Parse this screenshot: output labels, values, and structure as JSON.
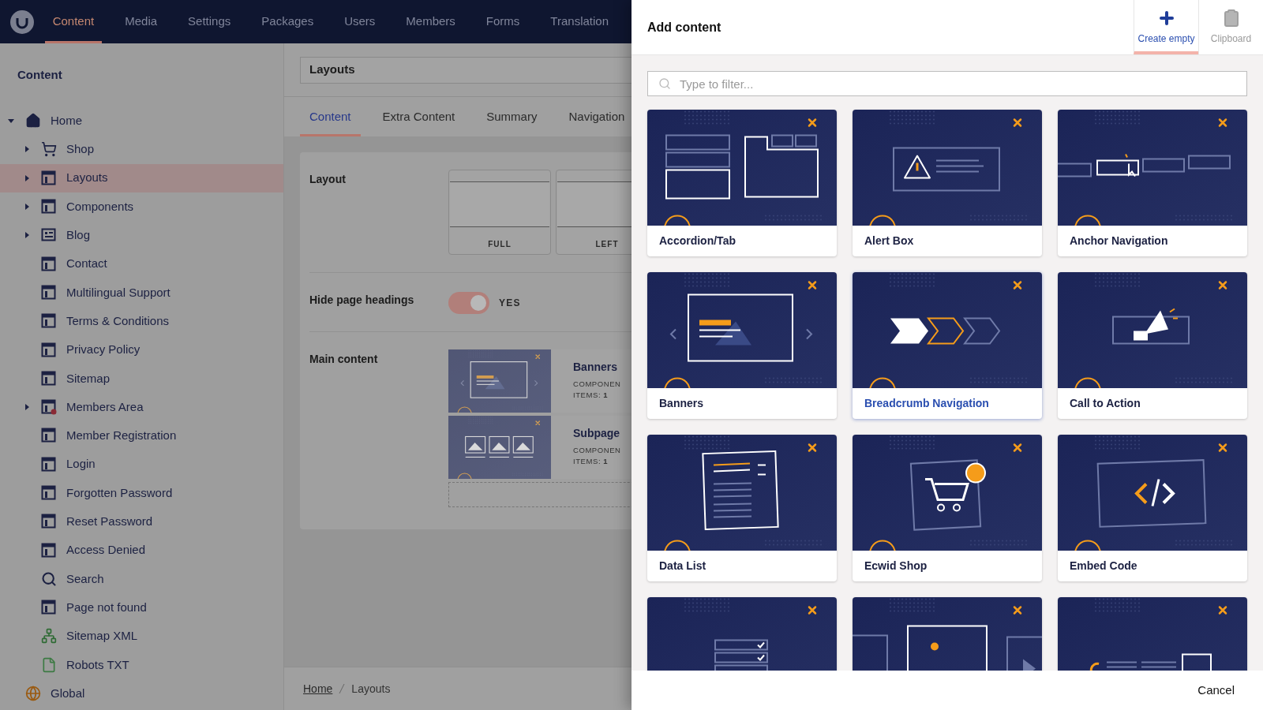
{
  "top_nav": {
    "items": [
      {
        "label": "Content",
        "selected": true
      },
      {
        "label": "Media",
        "selected": false
      },
      {
        "label": "Settings",
        "selected": false
      },
      {
        "label": "Packages",
        "selected": false
      },
      {
        "label": "Users",
        "selected": false
      },
      {
        "label": "Members",
        "selected": false
      },
      {
        "label": "Forms",
        "selected": false
      },
      {
        "label": "Translation",
        "selected": false
      }
    ]
  },
  "sidebar": {
    "title": "Content",
    "tree": [
      {
        "label": "Home",
        "kind": "home",
        "expandable": true,
        "expanded": true,
        "selected": false,
        "children": [
          {
            "label": "Shop",
            "kind": "cart",
            "expandable": true,
            "expanded": false,
            "selected": false
          },
          {
            "label": "Layouts",
            "kind": "layout",
            "expandable": true,
            "expanded": false,
            "selected": true
          },
          {
            "label": "Components",
            "kind": "layout",
            "expandable": true,
            "expanded": false,
            "selected": false
          },
          {
            "label": "Blog",
            "kind": "blog",
            "expandable": true,
            "expanded": false,
            "selected": false
          },
          {
            "label": "Contact",
            "kind": "layout",
            "expandable": false,
            "expanded": false,
            "selected": false
          },
          {
            "label": "Multilingual Support",
            "kind": "layout",
            "expandable": false,
            "expanded": false,
            "selected": false
          },
          {
            "label": "Terms & Conditions",
            "kind": "layout",
            "expandable": false,
            "expanded": false,
            "selected": false
          },
          {
            "label": "Privacy Policy",
            "kind": "layout",
            "expandable": false,
            "expanded": false,
            "selected": false
          },
          {
            "label": "Sitemap",
            "kind": "layout",
            "expandable": false,
            "expanded": false,
            "selected": false
          },
          {
            "label": "Members Area",
            "kind": "restricted",
            "expandable": true,
            "expanded": false,
            "selected": false
          },
          {
            "label": "Member Registration",
            "kind": "layout",
            "expandable": false,
            "expanded": false,
            "selected": false
          },
          {
            "label": "Login",
            "kind": "layout",
            "expandable": false,
            "expanded": false,
            "selected": false
          },
          {
            "label": "Forgotten Password",
            "kind": "layout",
            "expandable": false,
            "expanded": false,
            "selected": false
          },
          {
            "label": "Reset Password",
            "kind": "layout",
            "expandable": false,
            "expanded": false,
            "selected": false
          },
          {
            "label": "Access Denied",
            "kind": "layout",
            "expandable": false,
            "expanded": false,
            "selected": false
          },
          {
            "label": "Search",
            "kind": "search",
            "expandable": false,
            "expanded": false,
            "selected": false
          },
          {
            "label": "Page not found",
            "kind": "layout",
            "expandable": false,
            "expanded": false,
            "selected": false
          },
          {
            "label": "Sitemap XML",
            "kind": "sitemap",
            "expandable": false,
            "expanded": false,
            "selected": false
          },
          {
            "label": "Robots TXT",
            "kind": "file",
            "expandable": false,
            "expanded": false,
            "selected": false
          }
        ]
      },
      {
        "label": "Global",
        "kind": "globe",
        "expandable": false,
        "expanded": false,
        "selected": false
      }
    ]
  },
  "editor": {
    "name_field": "Layouts",
    "tabs": [
      {
        "label": "Content",
        "selected": true
      },
      {
        "label": "Extra Content",
        "selected": false
      },
      {
        "label": "Summary",
        "selected": false
      },
      {
        "label": "Navigation",
        "selected": false
      }
    ],
    "properties": [
      {
        "kind": "layout",
        "label": "Layout",
        "options": [
          "FULL",
          "LEFT"
        ]
      },
      {
        "kind": "toggle",
        "label": "Hide page headings",
        "on": true,
        "value_label": "YES"
      },
      {
        "kind": "blocks",
        "label": "Main content",
        "blocks": [
          {
            "title": "Banners",
            "kind": "banners",
            "type_label": "COMPONEN",
            "items": "ITEMS: **1**"
          },
          {
            "title": "Subpage",
            "kind": "gallery-row",
            "type_label": "COMPONEN",
            "items": "ITEMS: **1**"
          }
        ]
      }
    ]
  },
  "breadcrumb": [
    {
      "label": "Home",
      "kind": "link"
    },
    {
      "label": "Layouts",
      "kind": "current"
    }
  ],
  "dialog": {
    "title": "Add content",
    "actions": [
      {
        "label": "Create empty",
        "kind": "plus",
        "selected": true
      },
      {
        "label": "Clipboard",
        "kind": "clipboard",
        "selected": false
      }
    ],
    "filter_placeholder": "Type to filter...",
    "cards": [
      {
        "label": "Accordion/Tab",
        "kind": "accordion",
        "selected": false
      },
      {
        "label": "Alert Box",
        "kind": "alert",
        "selected": false
      },
      {
        "label": "Anchor Navigation",
        "kind": "anchor",
        "selected": false
      },
      {
        "label": "Banners",
        "kind": "banners",
        "selected": false
      },
      {
        "label": "Breadcrumb Navigation",
        "kind": "breadcrumb",
        "selected": true
      },
      {
        "label": "Call to Action",
        "kind": "cta",
        "selected": false
      },
      {
        "label": "Data List",
        "kind": "datalist",
        "selected": false
      },
      {
        "label": "Ecwid Shop",
        "kind": "shop",
        "selected": false
      },
      {
        "label": "Embed Code",
        "kind": "code",
        "selected": false
      },
      {
        "kind": "form",
        "selected": false
      },
      {
        "kind": "gallery",
        "selected": false
      },
      {
        "kind": "seo",
        "selected": false
      }
    ],
    "cancel": "Cancel"
  }
}
